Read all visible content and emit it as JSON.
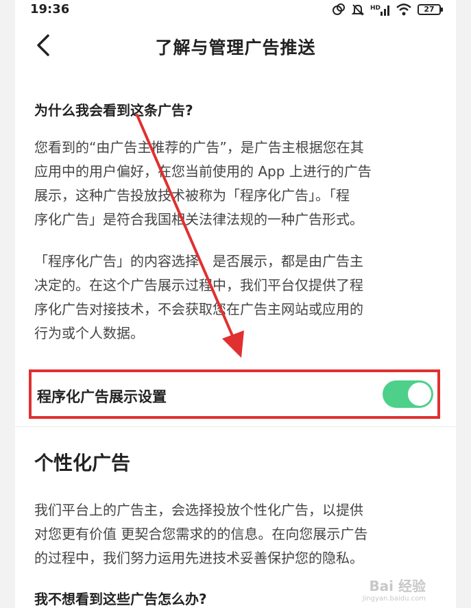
{
  "status_bar": {
    "time": "19:36",
    "network_label": "HD",
    "battery_level": "27"
  },
  "nav": {
    "title": "了解与管理广告推送"
  },
  "section1": {
    "question": "为什么我会看到这条广告?",
    "para1_lines": [
      "您看到的“由广告主推荐的广告”，是广告主根据您在其",
      "应用中的用户偏好，在您当前使用的 App 上进行的广告",
      "展示，这种广告投放技术被称为「程序化广告」。「程",
      "序化广告」是符合我国相关法律法规的一种广告形式。"
    ],
    "para2_lines": [
      "「程序化广告」的内容选择、是否展示，都是由广告主",
      "决定的。在这个广告展示过程中，我们平台仅提供了程",
      "序化广告对接技术，不会获取您在广告主网站或应用的",
      "行为或个人数据。"
    ]
  },
  "setting": {
    "label": "程序化广告展示设置",
    "enabled": true
  },
  "section2": {
    "heading": "个性化广告",
    "para_lines": [
      "我们平台上的广告主，会选择投放个性化广告，以提供",
      "对您更有价值 更契合您需求的的信息。在向您展示广告",
      "的过程中，我们努力运用先进技术妥善保护您的隐私。"
    ],
    "question": "我不想看到这些广告怎么办?"
  },
  "watermark": {
    "main": "Bai 经验",
    "sub": "jingyan.baidu.com"
  },
  "colors": {
    "toggle_on": "#4cd08a",
    "annotation_red": "#e03030"
  }
}
